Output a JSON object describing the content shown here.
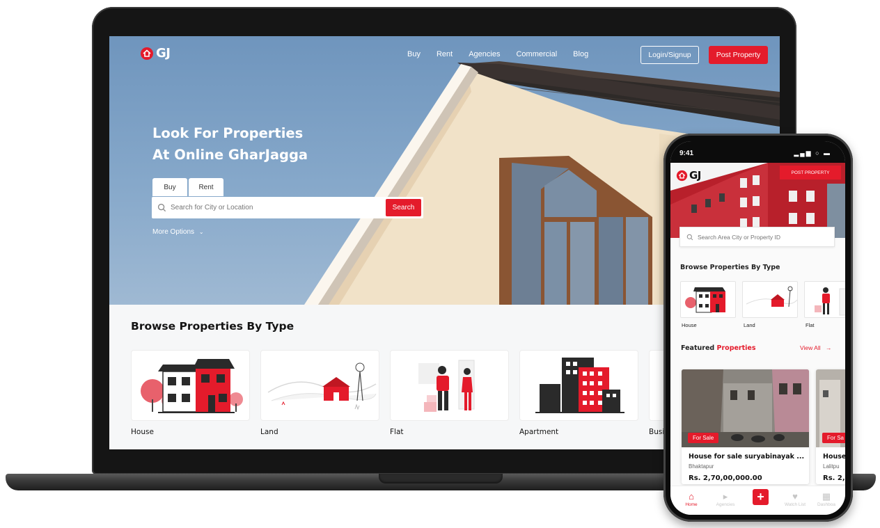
{
  "colors": {
    "accent": "#e41b2b",
    "dark": "#141414",
    "sky": "#7c9fc4"
  },
  "desktop": {
    "logo_text": "GJ",
    "nav": [
      "Buy",
      "Rent",
      "Agencies",
      "Commercial",
      "Blog"
    ],
    "login_label": "Login/Signup",
    "post_label": "Post Property",
    "hero_line1": "Look For Properties",
    "hero_line2": "At Online GharJagga",
    "tabs": [
      "Buy",
      "Rent"
    ],
    "search_placeholder": "Search for City or Location",
    "search_button": "Search",
    "more_options": "More Options",
    "browse_title": "Browse Properties By Type",
    "types": [
      "House",
      "Land",
      "Flat",
      "Apartment",
      "Busi"
    ]
  },
  "mobile": {
    "time": "9:41",
    "logo_text": "GJ",
    "post_label": "POST PROPERTY",
    "search_placeholder": "Search Area City or Property ID",
    "browse_title": "Browse Properties By Type",
    "types": [
      "House",
      "Land",
      "Flat"
    ],
    "featured_prefix": "Featured",
    "featured_accent": "Properties",
    "view_all": "View All",
    "listings": [
      {
        "badge": "For Sale",
        "title": "House for sale suryabinayak ...",
        "location": "Bhaktapur",
        "price": "Rs.  2,70,00,000.00"
      },
      {
        "badge": "For Sa",
        "title": "House",
        "location": "Lalitpu",
        "price": "Rs.  2,"
      }
    ],
    "tabbar": [
      "Home",
      "Agencies",
      "Watch List",
      "Dashboa"
    ]
  }
}
